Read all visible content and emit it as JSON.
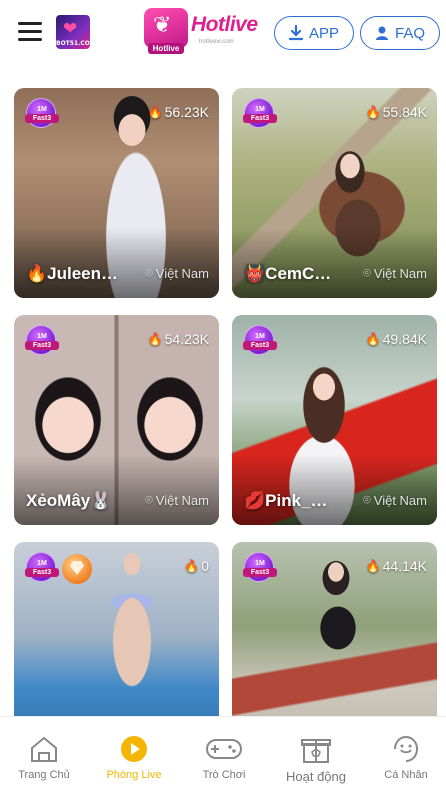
{
  "header": {
    "logo_small_text": "BOT51.COM",
    "brand_name": "Hotlive",
    "brand_tag": "Hotlive",
    "brand_site": "hotlivevi.com",
    "app_label": "APP",
    "faq_label": "FAQ"
  },
  "badge": {
    "line1": "1M",
    "line2": "Fast3"
  },
  "cards": [
    {
      "viewers": "56.23K",
      "name": "🔥Juleen…",
      "location": "Việt Nam"
    },
    {
      "viewers": "55.84K",
      "name": "👹CemC…",
      "location": "Việt Nam"
    },
    {
      "viewers": "54.23K",
      "name": "XẻoMây🐰",
      "location": "Việt Nam"
    },
    {
      "viewers": "49.84K",
      "name": "💋Pink_…",
      "location": "Việt Nam"
    },
    {
      "viewers": "0",
      "name": "",
      "location": ""
    },
    {
      "viewers": "44.14K",
      "name": "",
      "location": ""
    }
  ],
  "bottom_nav": [
    {
      "label": "Trang Chủ",
      "icon": "home-icon",
      "active": false
    },
    {
      "label": "Phòng Live",
      "icon": "play-icon",
      "active": true
    },
    {
      "label": "Trò Chơi",
      "icon": "gamepad-icon",
      "active": false
    },
    {
      "label": "Hoạt động",
      "icon": "gift-icon",
      "active": false
    },
    {
      "label": "Cá Nhân",
      "icon": "profile-icon",
      "active": false
    }
  ],
  "colors": {
    "accent_blue": "#2e6fd6",
    "brand_pink": "#e0208f",
    "active_yellow": "#f5b400"
  }
}
